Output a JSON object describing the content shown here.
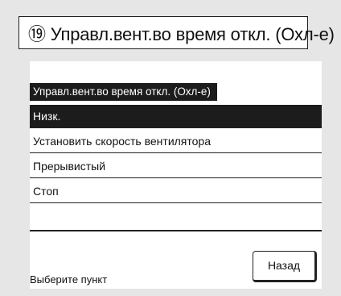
{
  "title": "⑲ Управл.вент.во время откл. (Охл-е)",
  "screen": {
    "subheader": "Управл.вент.во время откл. (Охл-е)",
    "menu_items": [
      {
        "label": "Низк.",
        "selected": true
      },
      {
        "label": "Установить скорость вентилятора",
        "selected": false
      },
      {
        "label": "Прерывистый",
        "selected": false
      },
      {
        "label": "Стоп",
        "selected": false
      }
    ],
    "status_text": "Выберите пункт",
    "back_label": "Назад"
  }
}
